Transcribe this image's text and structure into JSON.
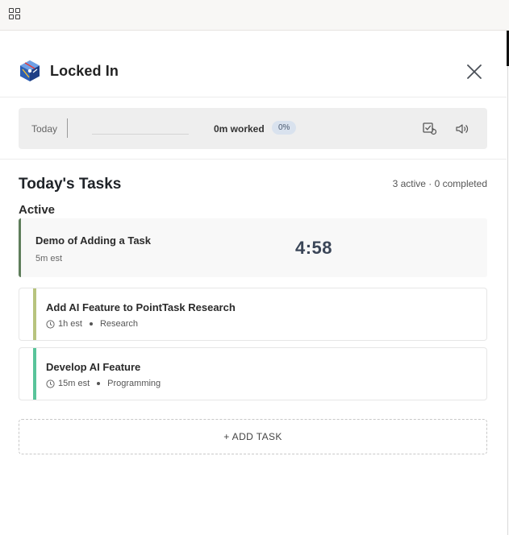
{
  "app": {
    "title": "Locked In"
  },
  "toolbar": {
    "apps_icon": "grid-icon"
  },
  "stats": {
    "today_label": "Today",
    "worked": "0m worked",
    "percent_label": "0%",
    "progress_fraction": 0.0
  },
  "tasks": {
    "heading": "Today's Tasks",
    "summary": "3 active · 0 completed",
    "active_label": "Active",
    "current": {
      "name": "Demo of Adding a Task",
      "estimate": "5m est",
      "timer": "4:58",
      "accent": "#5e7d5b"
    },
    "list": [
      {
        "name": "Add AI Feature to PointTask Research",
        "estimate": "1h est",
        "category": "Research",
        "accent": "#b8c47e"
      },
      {
        "name": "Develop AI Feature",
        "estimate": "15m est",
        "category": "Programming",
        "accent": "#59c49a"
      }
    ],
    "add_label": "+ ADD TASK"
  },
  "colors": {
    "timer": "#3b4658",
    "badge": "#d9e2ee"
  }
}
